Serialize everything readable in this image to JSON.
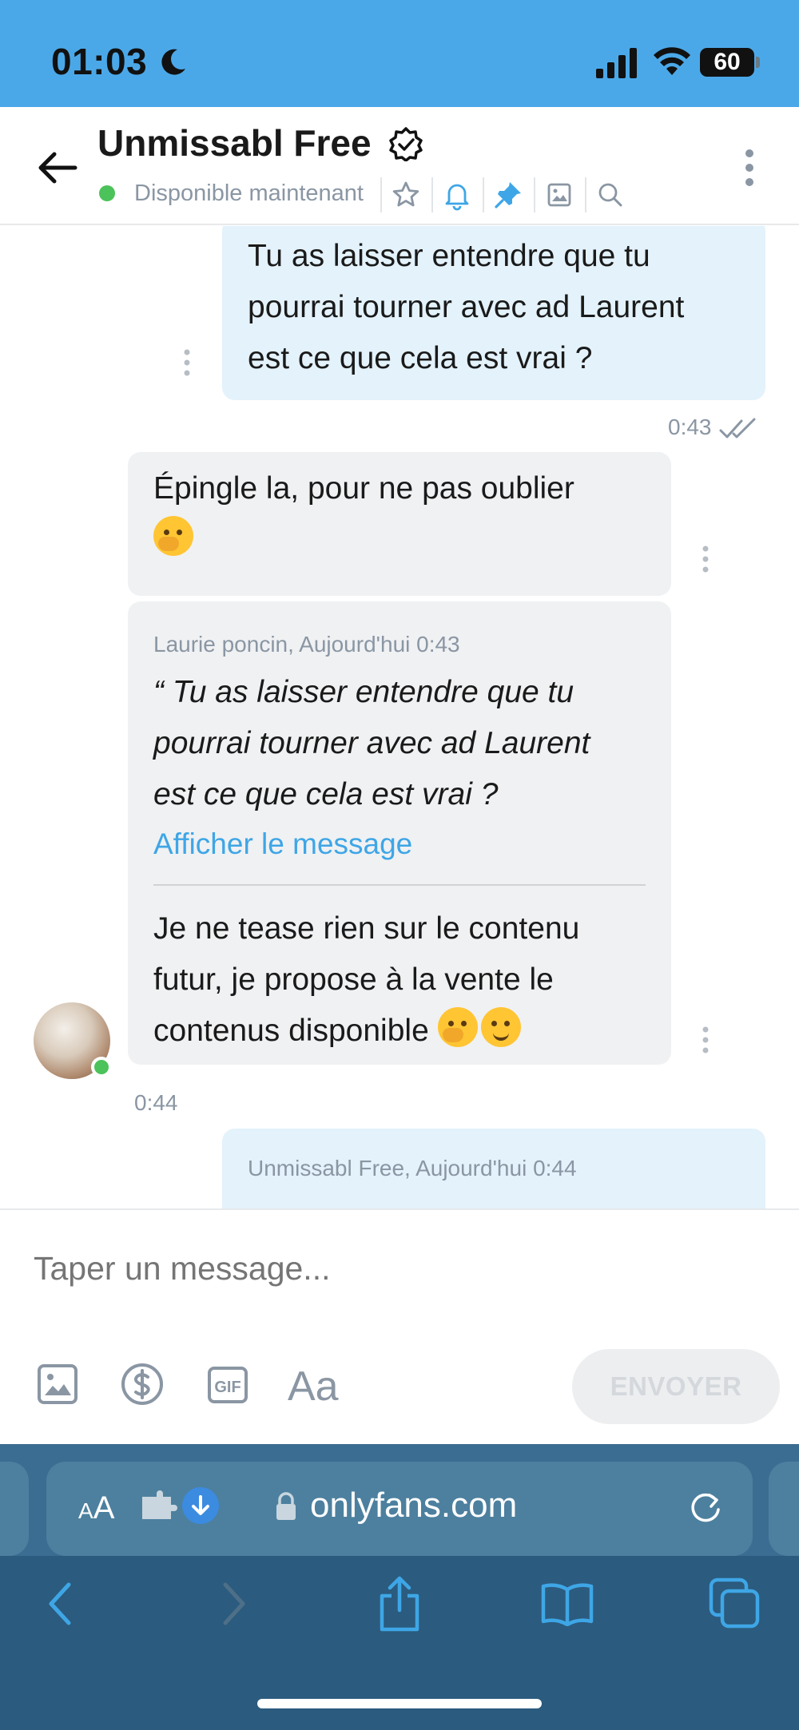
{
  "status_bar": {
    "time": "01:03",
    "battery": "60"
  },
  "header": {
    "title": "Unmissabl Free",
    "status": "Disponible maintenant",
    "icons": [
      "star-icon",
      "bell-icon",
      "pin-icon",
      "image-icon",
      "search-icon"
    ]
  },
  "messages": [
    {
      "direction": "out",
      "text": "Tu as laisser entendre que tu\npourrai tourner avec ad Laurent\nest ce que cela est vrai ?",
      "time": "0:43",
      "read": true
    },
    {
      "direction": "in",
      "text": "Épingle la, pour ne pas oublier",
      "emoji": [
        "🤭"
      ]
    },
    {
      "direction": "in",
      "quote": {
        "author_line": "Laurie poncin, Aujourd'hui 0:43",
        "text": "“ Tu as laisser entendre que tu\npourrai tourner avec ad Laurent\nest ce que cela est vrai ?",
        "link": "Afficher le message"
      },
      "text": "Je ne tease rien sur le contenu\nfutur, je propose à la vente le\ncontenus disponible",
      "emoji": [
        "🤭",
        "😏"
      ],
      "time": "0:44"
    },
    {
      "direction": "out",
      "quote": {
        "author_line": "Unmissabl Free, Aujourd'hui 0:44"
      }
    }
  ],
  "composer": {
    "placeholder": "Taper un message...",
    "send_label": "ENVOYER",
    "tools": [
      "image-icon",
      "dollar-icon",
      "gif-icon",
      "font-icon"
    ]
  },
  "browser": {
    "aa_label_small": "A",
    "aa_label_large": "A",
    "url": "onlyfans.com"
  },
  "colors": {
    "status_bar": "#4ba8e8",
    "outgoing_bubble": "#e3f2fb",
    "incoming_bubble": "#f0f1f3",
    "accent": "#3ea6e6",
    "online": "#4cc25a",
    "browser_bar": "#3a6d91"
  }
}
